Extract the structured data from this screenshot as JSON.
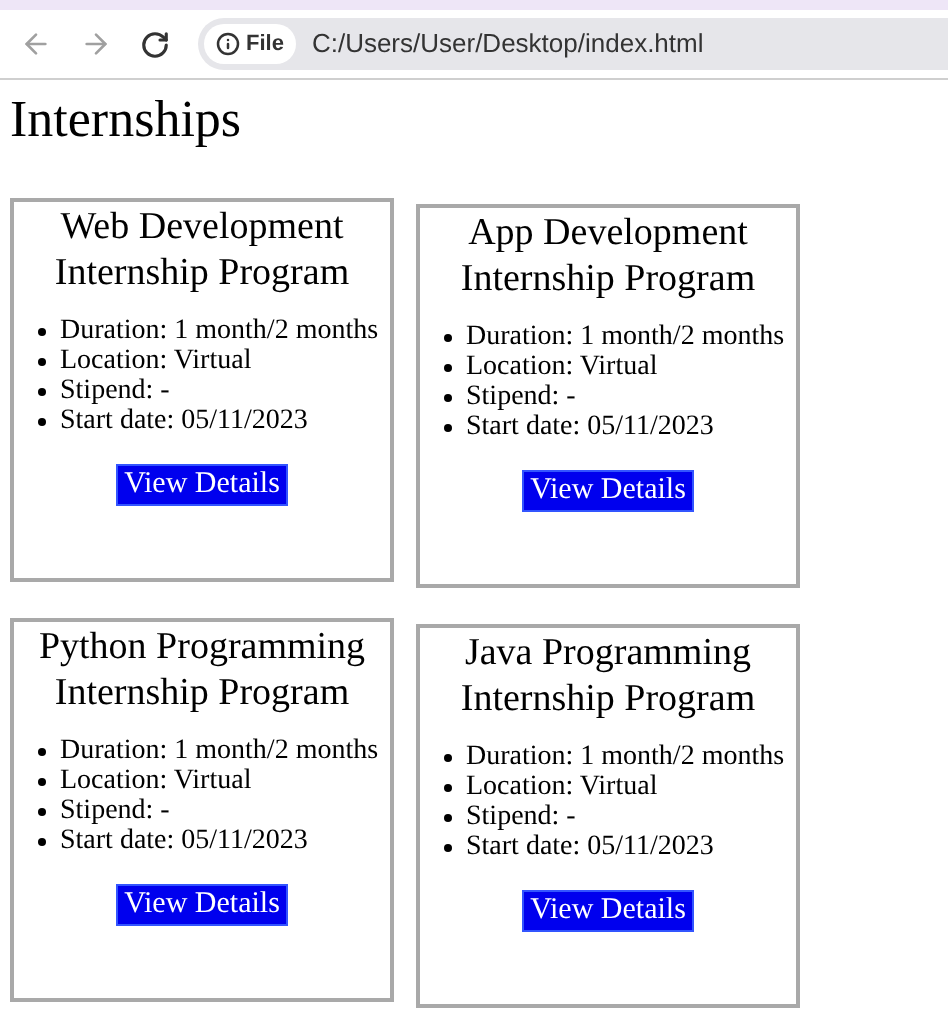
{
  "browser": {
    "chip": "File",
    "address": "C:/Users/User/Desktop/index.html"
  },
  "heading": "Internships",
  "cards": [
    {
      "title": "Web Development Internship Program",
      "details": [
        "Duration: 1 month/2 months",
        "Location: Virtual",
        "Stipend: -",
        "Start date: 05/11/2023"
      ],
      "button": "View Details"
    },
    {
      "title": "App Development Internship Program",
      "details": [
        "Duration: 1 month/2 months",
        "Location: Virtual",
        "Stipend: -",
        "Start date: 05/11/2023"
      ],
      "button": "View Details"
    },
    {
      "title": "Python Programming Internship Program",
      "details": [
        "Duration: 1 month/2 months",
        "Location: Virtual",
        "Stipend: -",
        "Start date: 05/11/2023"
      ],
      "button": "View Details"
    },
    {
      "title": "Java Programming Internship Program",
      "details": [
        "Duration: 1 month/2 months",
        "Location: Virtual",
        "Stipend: -",
        "Start date: 05/11/2023"
      ],
      "button": "View Details"
    }
  ]
}
